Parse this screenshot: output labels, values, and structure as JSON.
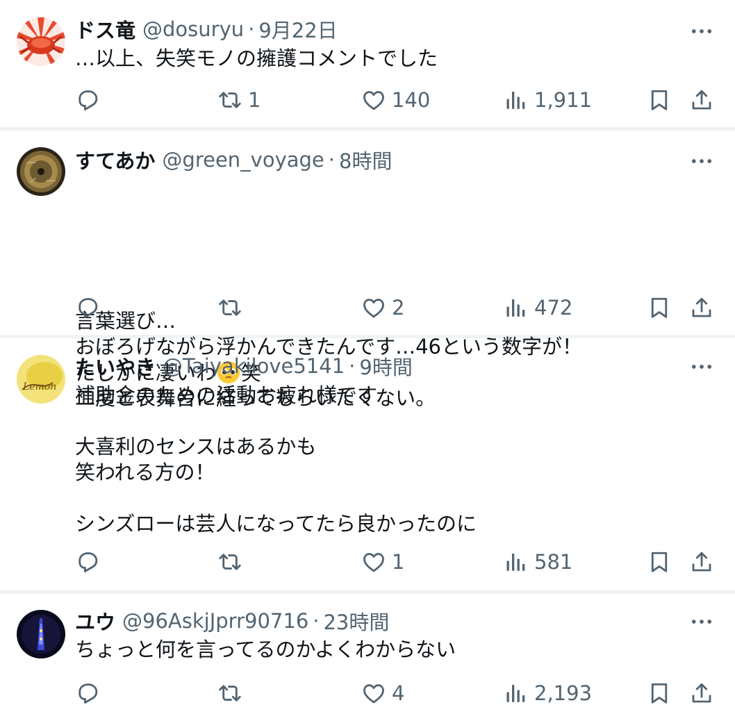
{
  "colors": {
    "text": "#0f1419",
    "secondary": "#536471",
    "divider": "#eff3f4"
  },
  "tweets": [
    {
      "name": "ドス竜",
      "handle": "@dosuryu",
      "separator": "·",
      "time": "9月22日",
      "avatar_icon": "crab-avatar",
      "lines": [
        "…以上、失笑モノの擁護コメントでした"
      ],
      "replies": "",
      "retweets": "1",
      "likes": "140",
      "views": "1,911"
    },
    {
      "name": "すてあか",
      "handle": "@green_voyage",
      "separator": "·",
      "time": "8時間",
      "avatar_icon": "golden-record-avatar",
      "lines": [
        "言葉選び…",
        "おぼろげながら浮かんできたんです…46という数字が！",
        "たしかに凄いわ",
        "二度と表舞台に経ってもらいたくない。"
      ],
      "emoji_suffix": "笑",
      "replies": "",
      "retweets": "",
      "likes": "2",
      "views": "472"
    },
    {
      "name": "たいやき",
      "handle": "@Taiyakilove5141",
      "separator": "·",
      "time": "9時間",
      "avatar_icon": "lemon-avatar",
      "lines": [
        "補助金のための活動お疲れ様です",
        "",
        "大喜利のセンスはあるかも",
        "笑われる方の！",
        "",
        "シンズローは芸人になってたら良かったのに"
      ],
      "replies": "",
      "retweets": "",
      "likes": "1",
      "views": "581"
    },
    {
      "name": "ユウ",
      "handle": "@96AskjJprr90716",
      "separator": "·",
      "time": "23時間",
      "avatar_icon": "night-tower-avatar",
      "lines": [
        "ちょっと何を言ってるのかよくわからない"
      ],
      "replies": "",
      "retweets": "",
      "likes": "4",
      "views": "2,193"
    }
  ]
}
